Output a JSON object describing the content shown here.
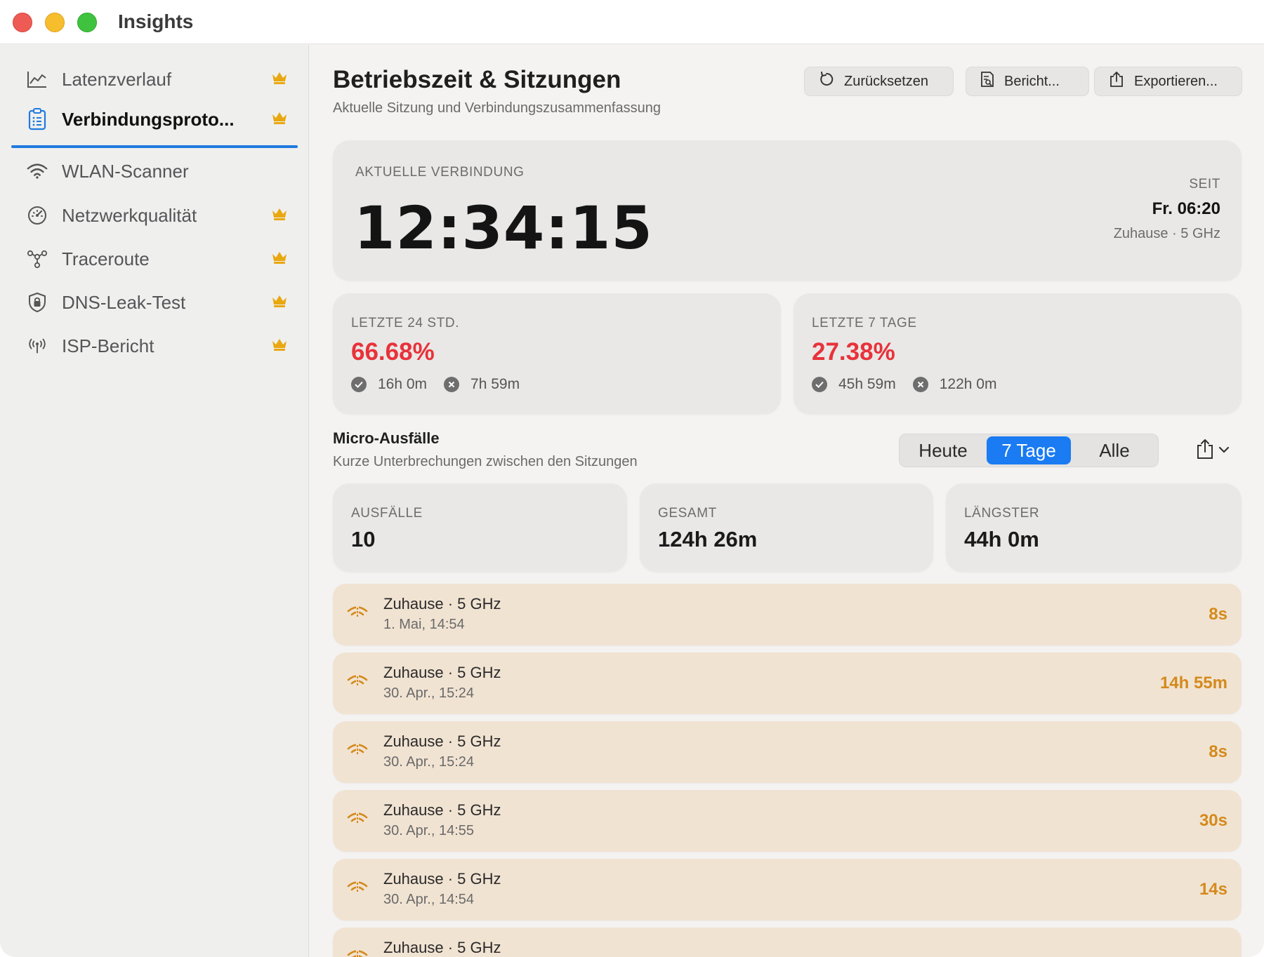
{
  "window": {
    "title": "Insights"
  },
  "sidebar": {
    "items": [
      {
        "label": "Latenzverlauf",
        "icon": "chart-line-icon",
        "premium": true
      },
      {
        "label": "Verbindungsproto...",
        "icon": "clipboard-list-icon",
        "premium": true,
        "active": true
      },
      {
        "label": "WLAN-Scanner",
        "icon": "wifi-icon",
        "premium": false
      },
      {
        "label": "Netzwerkqualität",
        "icon": "gauge-icon",
        "premium": true
      },
      {
        "label": "Traceroute",
        "icon": "route-nodes-icon",
        "premium": true
      },
      {
        "label": "DNS-Leak-Test",
        "icon": "shield-lock-icon",
        "premium": true
      },
      {
        "label": "ISP-Bericht",
        "icon": "antenna-icon",
        "premium": true
      }
    ]
  },
  "header": {
    "title": "Betriebszeit & Sitzungen",
    "subtitle": "Aktuelle Sitzung und Verbindungszusammenfassung",
    "buttons": {
      "reset": "Zurücksetzen",
      "report": "Bericht...",
      "export": "Exportieren..."
    }
  },
  "current": {
    "caption": "AKTUELLE VERBINDUNG",
    "duration": "12:34:15",
    "since_caption": "SEIT",
    "since_value": "Fr. 06:20",
    "network": "Zuhause · 5 GHz"
  },
  "stats": [
    {
      "caption": "LETZTE 24 STD.",
      "percent": "66.68%",
      "up": "16h 0m",
      "down": "7h 59m"
    },
    {
      "caption": "LETZTE 7 TAGE",
      "percent": "27.38%",
      "up": "45h 59m",
      "down": "122h 0m"
    }
  ],
  "micro": {
    "title": "Micro-Ausfälle",
    "subtitle": "Kurze Unterbrechungen zwischen den Sitzungen",
    "segments": [
      "Heute",
      "7 Tage",
      "Alle"
    ],
    "selected_segment": "7 Tage",
    "summary": [
      {
        "caption": "AUSFÄLLE",
        "value": "10"
      },
      {
        "caption": "GESAMT",
        "value": "124h 26m"
      },
      {
        "caption": "LÄNGSTER",
        "value": "44h 0m"
      }
    ],
    "outages": [
      {
        "network": "Zuhause · 5 GHz",
        "time": "1. Mai, 14:54",
        "duration": "8s"
      },
      {
        "network": "Zuhause · 5 GHz",
        "time": "30. Apr., 15:24",
        "duration": "14h 55m"
      },
      {
        "network": "Zuhause · 5 GHz",
        "time": "30. Apr., 15:24",
        "duration": "8s"
      },
      {
        "network": "Zuhause · 5 GHz",
        "time": "30. Apr., 14:55",
        "duration": "30s"
      },
      {
        "network": "Zuhause · 5 GHz",
        "time": "30. Apr., 14:54",
        "duration": "14s"
      },
      {
        "network": "Zuhause · 5 GHz",
        "time": "",
        "duration": ""
      }
    ]
  },
  "colors": {
    "accent": "#1a7bf2",
    "danger": "#e8323a",
    "warning": "#d48a1c",
    "crown": "#e9a80f"
  }
}
